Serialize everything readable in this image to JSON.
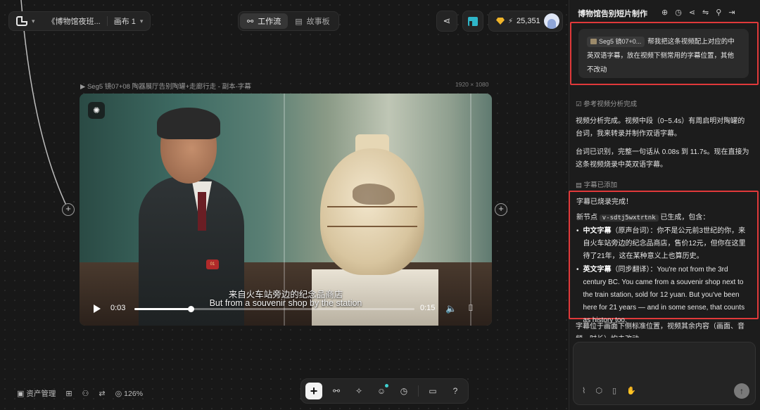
{
  "toolbar": {
    "project_title": "《博物馆夜班...",
    "canvas_name": "画布 1",
    "tabs": [
      {
        "label": "工作流",
        "icon": "workflow-icon",
        "active": true
      },
      {
        "label": "故事板",
        "icon": "storyboard-icon",
        "active": false
      }
    ],
    "credits": "25,351"
  },
  "video": {
    "label": "Seg5 镜07+08 陶器展厅告别陶罐+走廊行走 - 副本-字幕",
    "dims": "1920 × 1080",
    "subtitle_cn": "来自火车站旁边的纪念品商店",
    "subtitle_en": "But from a souvenir shop by the station",
    "time_current": "0:03",
    "time_total": "0:15",
    "progress": 0.2
  },
  "bottom_left": {
    "assets_label": "资产管理",
    "zoom": "126%"
  },
  "panel": {
    "title": "博物馆告别短片制作",
    "user_msg": {
      "chip": "Seg5 镜07+0...",
      "text": "帮我把这条视频配上对应的中英双语字幕，放在视频下侧常用的字幕位置，其他不改动"
    },
    "section1": "参考视频分析完成",
    "para1": "视频分析完成。视频中段（0~5.4s）有周启明对陶罐的台词，我来转录并制作双语字幕。",
    "para2": "台词已识别，完整一句话从 0.08s 到 11.7s。现在直接为这条视频烧录中英双语字幕。",
    "section2": "字幕已添加",
    "result": {
      "line1": "字幕已烧录完成！",
      "node_prefix": "新节点",
      "node_code": "v-sdtj5wxtrtnk",
      "node_suffix": "已生成，包含：",
      "bullet1_title": "中文字幕",
      "bullet1_text": "（原声台词）：你不是公元前3世纪的你，来自火车站旁边的纪念品商店，售价12元，但你在这里待了21年，这在某种意义上也算历史。",
      "bullet2_title": "英文字幕",
      "bullet2_text": "（同步翻译）：You're not from the 3rd century BC. You came from a souvenir shop next to the train station, sold for 12 yuan. But you've been here for 21 years — and in some sense, that counts as history too."
    },
    "para3": "字幕位于画面下侧标准位置，视频其余内容（画面、音频、时长）均未改动。"
  },
  "colors": {
    "highlight": "#e0393a",
    "accent": "#2fb6c9",
    "gem": "#f0b429"
  }
}
